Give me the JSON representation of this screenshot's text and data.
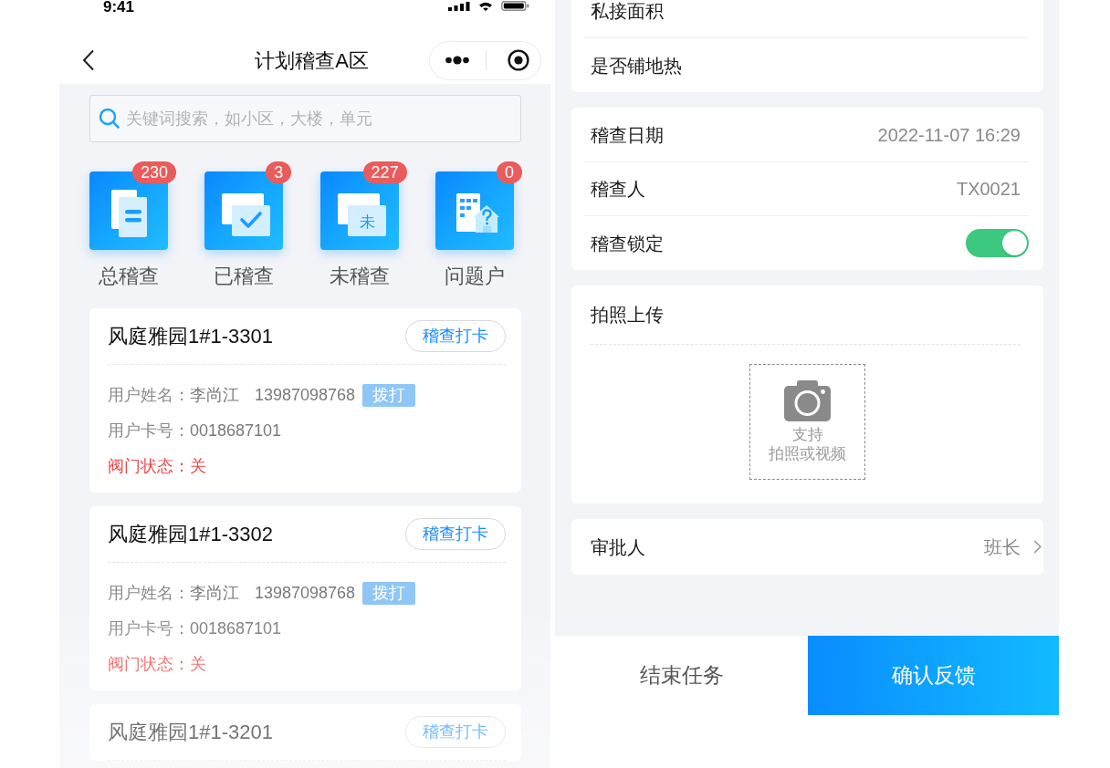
{
  "left_screen": {
    "status_bar": {
      "time": "9:41"
    },
    "nav_bar": {
      "title": "计划稽查A区"
    },
    "search": {
      "placeholder": "关键词搜索，如小区，大楼，单元"
    },
    "stats": [
      {
        "kind": "total",
        "label": "总稽查",
        "count": "230"
      },
      {
        "kind": "done",
        "label": "已稽查",
        "count": "3"
      },
      {
        "kind": "pending",
        "label": "未稽查",
        "count": "227",
        "icon_glyph": "未"
      },
      {
        "kind": "problem",
        "label": "问题户",
        "count": "0"
      }
    ],
    "records": [
      {
        "title": "风庭雅园1#1-3301",
        "action": "稽查打卡",
        "user": {
          "label": "用户姓名：",
          "name": "李尚江",
          "phone": "13987098768",
          "call": "拨打"
        },
        "card": {
          "label": "用户卡号：",
          "value": "0018687101"
        },
        "valve": {
          "label": "阀门状态：",
          "value": "关"
        }
      },
      {
        "title": "风庭雅园1#1-3302",
        "action": "稽查打卡",
        "user": {
          "label": "用户姓名：",
          "name": "李尚江",
          "phone": "13987098768",
          "call": "拨打"
        },
        "card": {
          "label": "用户卡号：",
          "value": "0018687101"
        },
        "valve": {
          "label": "阀门状态：",
          "value": "关"
        }
      },
      {
        "title": "风庭雅园1#1-3201",
        "action": "稽查打卡"
      }
    ]
  },
  "right_screen": {
    "groups": [
      {
        "rows": [
          {
            "kind": "text",
            "label": "私接面积"
          },
          {
            "kind": "text",
            "label": "是否铺地热"
          }
        ]
      },
      {
        "rows": [
          {
            "kind": "text",
            "label": "稽查日期",
            "value": "2022-11-07 16:29"
          },
          {
            "kind": "text",
            "label": "稽查人",
            "value": "TX0021"
          },
          {
            "kind": "toggle",
            "label": "稽查锁定",
            "on": true
          }
        ]
      }
    ],
    "upload": {
      "title": "拍照上传",
      "hint_lines": [
        "支持",
        "拍照或视频"
      ]
    },
    "approver": {
      "label": "审批人",
      "value": "班长"
    },
    "actions": [
      {
        "kind": "secondary",
        "label": "结束任务"
      },
      {
        "kind": "primary",
        "label": "确认反馈"
      }
    ]
  }
}
